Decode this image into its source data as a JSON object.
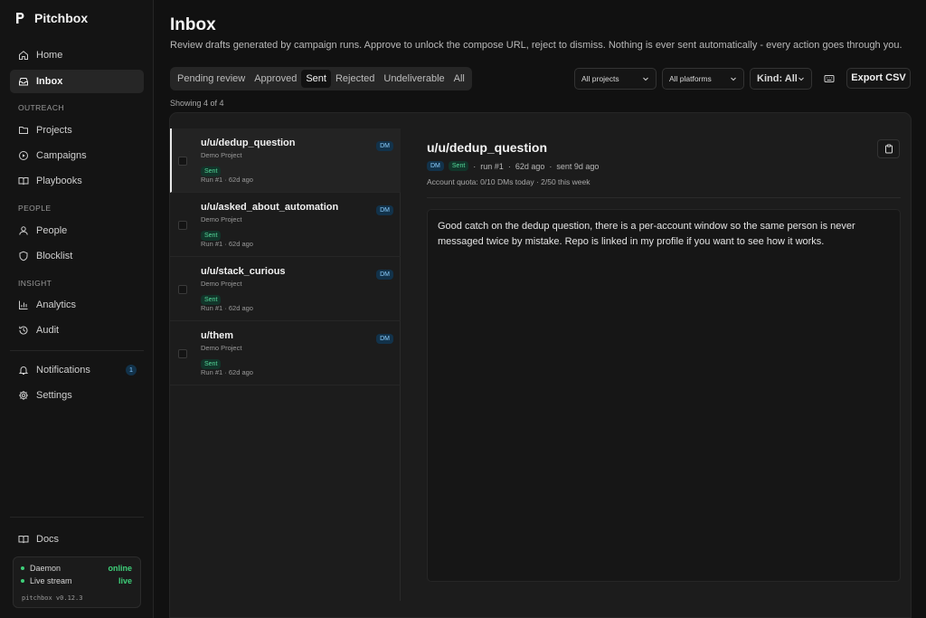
{
  "app": {
    "name": "Pitchbox",
    "version": "pitchbox v0.12.3"
  },
  "sidebar": {
    "home": "Home",
    "inbox": "Inbox",
    "section_outreach": "OUTREACH",
    "projects": "Projects",
    "campaigns": "Campaigns",
    "playbooks": "Playbooks",
    "section_people": "PEOPLE",
    "people": "People",
    "blocklist": "Blocklist",
    "section_insight": "INSIGHT",
    "analytics": "Analytics",
    "audit": "Audit",
    "notifications": "Notifications",
    "notifications_count": "1",
    "settings": "Settings",
    "docs": "Docs",
    "status": {
      "daemon_label": "Daemon",
      "daemon_value": "online",
      "stream_label": "Live stream",
      "stream_value": "live"
    }
  },
  "page": {
    "title": "Inbox",
    "subtitle": "Review drafts generated by campaign runs. Approve to unlock the compose URL, reject to dismiss. Nothing is ever sent automatically - every action goes through you."
  },
  "tabs": [
    "Pending review",
    "Approved",
    "Sent",
    "Rejected",
    "Undeliverable",
    "All"
  ],
  "active_tab": "Sent",
  "filters": {
    "project": "All projects",
    "platform": "All platforms",
    "kind": "Kind: All",
    "export": "Export CSV"
  },
  "showing": "Showing 4 of 4",
  "items": [
    {
      "title": "u/u/dedup_question",
      "project": "Demo Project",
      "status": "Sent",
      "run": "Run #1",
      "age": "62d ago",
      "kind": "DM"
    },
    {
      "title": "u/u/asked_about_automation",
      "project": "Demo Project",
      "status": "Sent",
      "run": "Run #1",
      "age": "62d ago",
      "kind": "DM"
    },
    {
      "title": "u/u/stack_curious",
      "project": "Demo Project",
      "status": "Sent",
      "run": "Run #1",
      "age": "62d ago",
      "kind": "DM"
    },
    {
      "title": "u/them",
      "project": "Demo Project",
      "status": "Sent",
      "run": "Run #1",
      "age": "62d ago",
      "kind": "DM"
    }
  ],
  "detail": {
    "title": "u/u/dedup_question",
    "kind": "DM",
    "status": "Sent",
    "run": "run #1",
    "age": "62d ago",
    "sent": "sent 9d ago",
    "quota": "Account quota: 0/10 DMs today · 2/50 this week",
    "message": "Good catch on the dedup question, there is a per-account window so the same person is never messaged twice by mistake. Repo is linked in my profile if you want to see how it works."
  }
}
